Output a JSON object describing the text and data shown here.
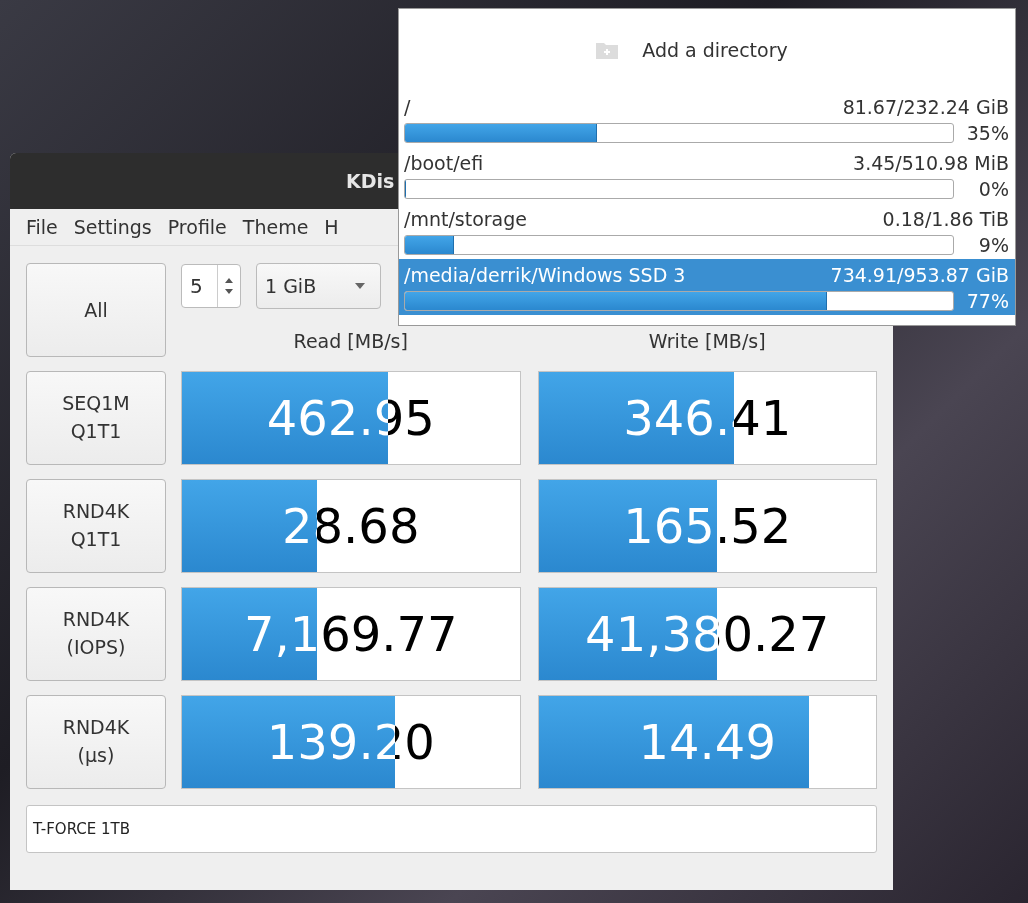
{
  "window": {
    "title": "KDis"
  },
  "menu": [
    {
      "label": "File"
    },
    {
      "label": "Settings"
    },
    {
      "label": "Profile"
    },
    {
      "label": "Theme"
    },
    {
      "label": "H"
    }
  ],
  "all_button": {
    "label": "All"
  },
  "loops": {
    "value": "5"
  },
  "size": {
    "value": "1 GiB"
  },
  "columns": [
    "Read [MB/s]",
    "Write [MB/s]"
  ],
  "tests": [
    {
      "label": [
        "SEQ1M",
        "Q1T1"
      ],
      "read": {
        "value": "462.95",
        "level": 0.61
      },
      "write": {
        "value": "346.41",
        "level": 0.58
      }
    },
    {
      "label": [
        "RND4K",
        "Q1T1"
      ],
      "read": {
        "value": "28.68",
        "level": 0.4
      },
      "write": {
        "value": "165.52",
        "level": 0.53
      }
    },
    {
      "label": [
        "RND4K",
        "(IOPS)"
      ],
      "read": {
        "value": "7,169.77",
        "level": 0.4
      },
      "write": {
        "value": "41,380.27",
        "level": 0.53
      }
    },
    {
      "label": [
        "RND4K",
        "(µs)"
      ],
      "read": {
        "value": "139.20",
        "level": 0.63
      },
      "write": {
        "value": "14.49",
        "level": 0.8
      }
    }
  ],
  "comment": {
    "value": "T-FORCE 1TB"
  },
  "directory_popup": {
    "add_label": "Add a directory",
    "items": [
      {
        "path": "/",
        "size": "81.67/232.24 GiB",
        "level": 0.35,
        "percent": "35%",
        "selected": false
      },
      {
        "path": "/boot/efi",
        "size": "3.45/510.98 MiB",
        "level": 0.0,
        "percent": "0%",
        "selected": false
      },
      {
        "path": "/mnt/storage",
        "size": "0.18/1.86 TiB",
        "level": 0.09,
        "percent": "9%",
        "selected": false
      },
      {
        "path": "/media/derrik/Windows SSD 3",
        "size": "734.91/953.87 GiB",
        "level": 0.77,
        "percent": "77%",
        "selected": true
      }
    ]
  }
}
